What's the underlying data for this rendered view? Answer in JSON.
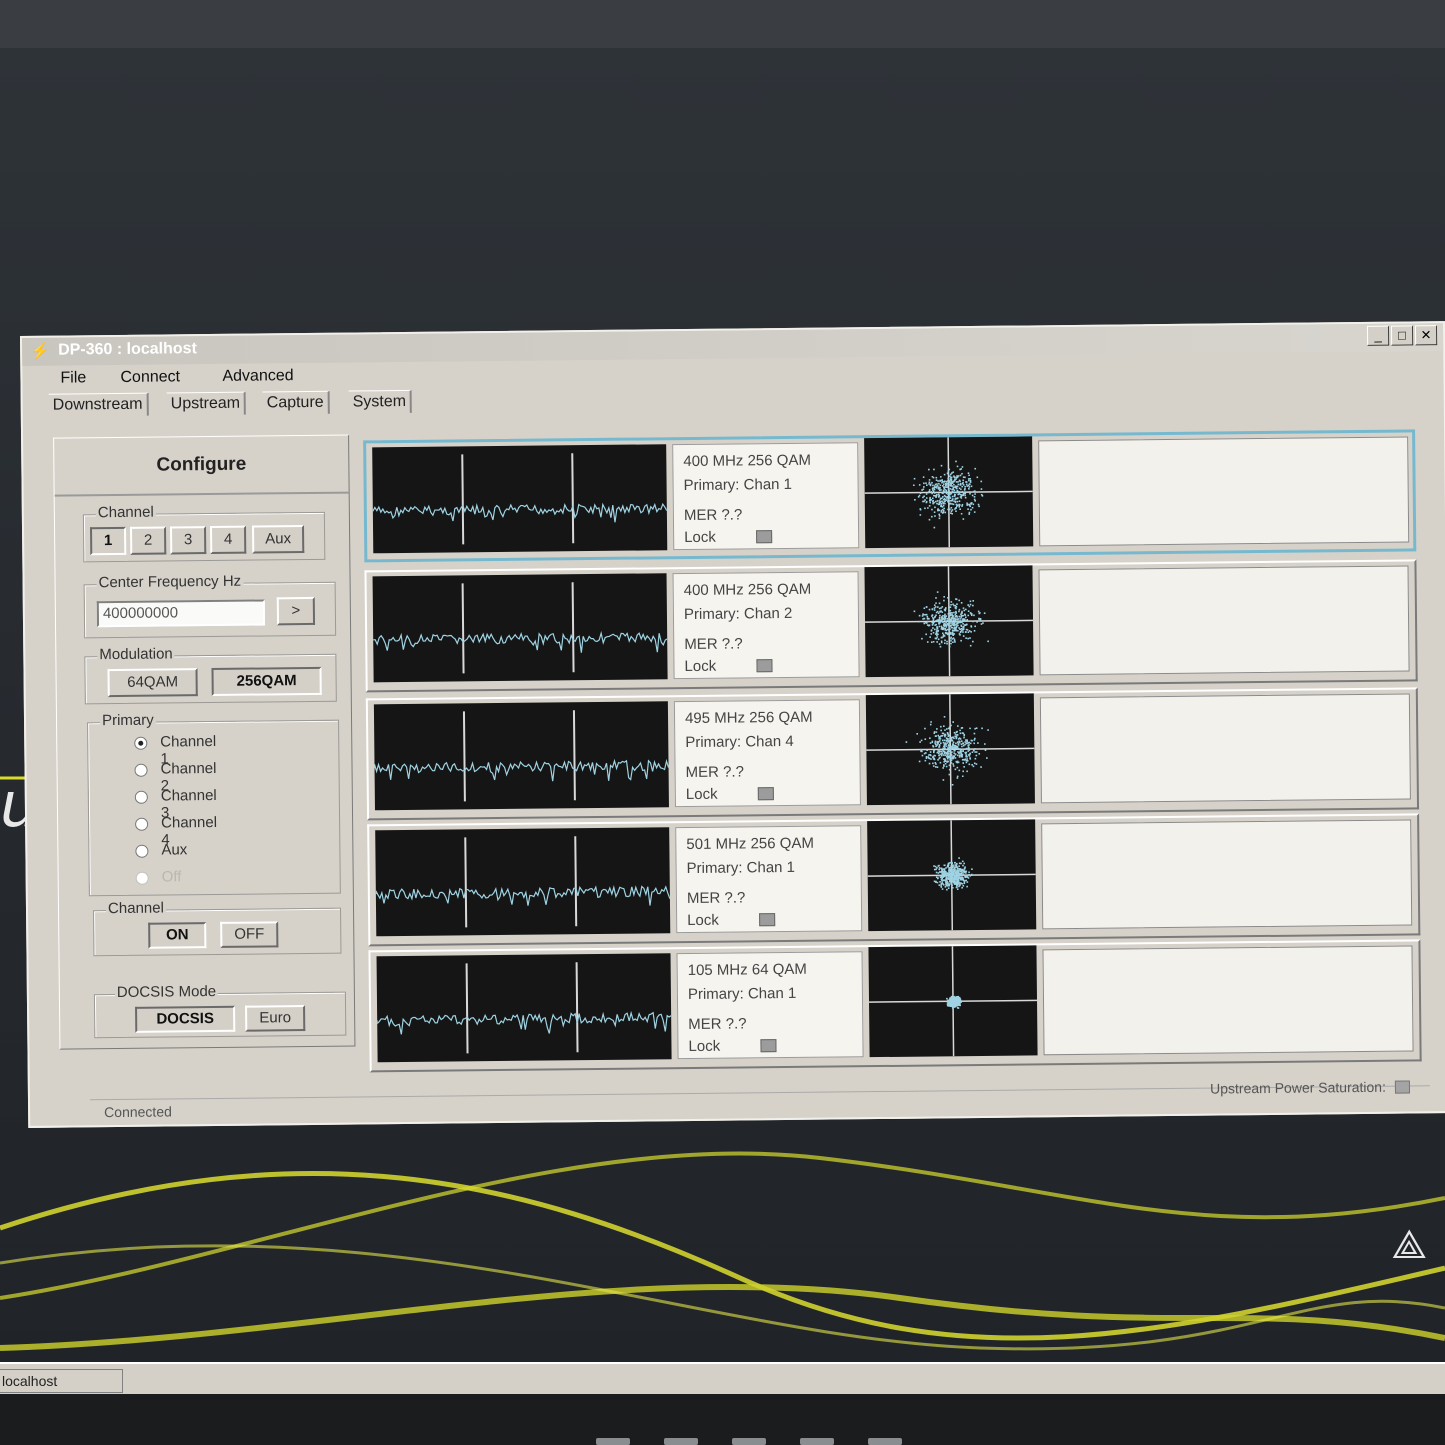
{
  "window": {
    "title": "DP-360 : localhost",
    "controls": [
      "_",
      "□",
      "✕"
    ]
  },
  "menu": [
    "File",
    "Connect",
    "Advanced"
  ],
  "tabs": [
    "Downstream",
    "Upstream",
    "Capture",
    "System"
  ],
  "configure": {
    "title": "Configure",
    "channel_group": {
      "label": "Channel",
      "buttons": [
        "1",
        "2",
        "3",
        "4",
        "Aux"
      ],
      "selected": "1"
    },
    "frequency": {
      "label": "Center Frequency Hz",
      "value": "400000000",
      "go_label": ">"
    },
    "modulation": {
      "label": "Modulation",
      "options": [
        "64QAM",
        "256QAM"
      ],
      "selected": "256QAM"
    },
    "primary": {
      "label": "Primary",
      "options": [
        "Channel 1",
        "Channel 2",
        "Channel 3",
        "Channel 4",
        "Aux",
        "Off"
      ],
      "selected": "Channel 1",
      "disabled": [
        "Off"
      ]
    },
    "channel_power": {
      "label": "Channel",
      "on_label": "ON",
      "off_label": "OFF",
      "selected": "ON"
    },
    "docsis": {
      "label": "DOCSIS Mode",
      "options": [
        "DOCSIS",
        "Euro"
      ],
      "selected": "DOCSIS"
    }
  },
  "channels": [
    {
      "freq_mod": "400 MHz  256 QAM",
      "primary": "Primary: Chan 1",
      "mer": "MER    ?.?",
      "lock": "Lock",
      "constellation_spread": 1.0
    },
    {
      "freq_mod": "400 MHz  256 QAM",
      "primary": "Primary: Chan 2",
      "mer": "MER    ?.?",
      "lock": "Lock",
      "constellation_spread": 0.95
    },
    {
      "freq_mod": "495 MHz  256 QAM",
      "primary": "Primary: Chan 4",
      "mer": "MER    ?.?",
      "lock": "Lock",
      "constellation_spread": 1.0
    },
    {
      "freq_mod": "501 MHz  256 QAM",
      "primary": "Primary: Chan 1",
      "mer": "MER    ?.?",
      "lock": "Lock",
      "constellation_spread": 0.55
    },
    {
      "freq_mod": "105 MHz  64 QAM",
      "primary": "Primary: Chan 1",
      "mer": "MER    ?.?",
      "lock": "Lock",
      "constellation_spread": 0.2
    }
  ],
  "status": {
    "left": "Connected",
    "right": "Upstream Power Saturation:"
  },
  "taskbar": {
    "item": "localhost"
  },
  "colors": {
    "trace": "#9fd3e3",
    "active_border": "#76b9cf",
    "swoosh": "#d9dc2e"
  }
}
